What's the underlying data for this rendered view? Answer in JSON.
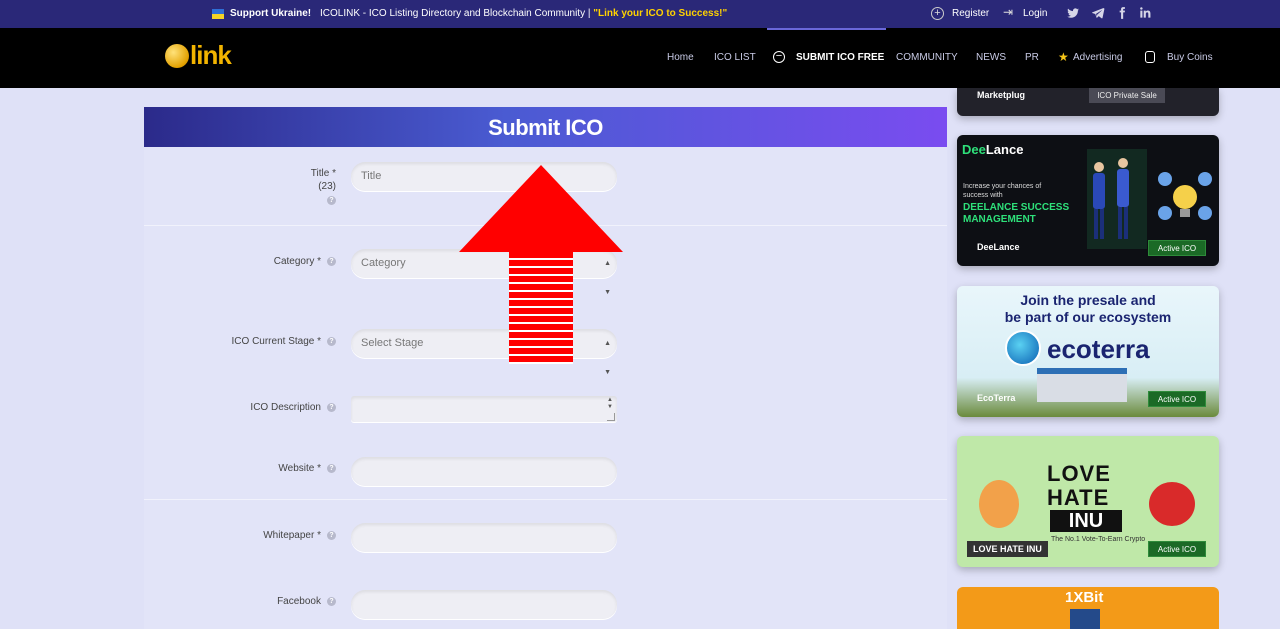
{
  "topbar": {
    "support": "Support Ukraine!",
    "tagline_prefix": "ICOLINK - ICO Listing Directory and Blockchain Community | ",
    "tagline_highlight": "\"Link your ICO to Success!\"",
    "register": "Register",
    "login": "Login",
    "social_icons": [
      "twitter-icon",
      "telegram-icon",
      "facebook-icon",
      "linkedin-icon"
    ]
  },
  "header": {
    "logo_text": "link",
    "nav": {
      "home": "Home",
      "ico_list": "ICO LIST",
      "submit": "SUBMIT ICO FREE",
      "community": "COMMUNITY",
      "news": "NEWS",
      "pr": "PR",
      "advertising": "Advertising",
      "buy_coins": "Buy Coins"
    }
  },
  "form": {
    "title": "Submit ICO",
    "fields": {
      "title_label": "Title *",
      "title_count": "(23)",
      "title_placeholder": "Title",
      "category_label": "Category *",
      "category_value": "Category",
      "stage_label": "ICO Current Stage *",
      "stage_value": "Select Stage",
      "description_label": "ICO Description",
      "website_label": "Website *",
      "whitepaper_label": "Whitepaper *",
      "facebook_label": "Facebook"
    }
  },
  "sidebar": {
    "ads": [
      {
        "name": "Marketplug",
        "status": "ICO Private Sale"
      },
      {
        "name": "DeeLance",
        "brand_a": "Dee",
        "brand_b": "Lance",
        "line1": "Increase your chances of success with",
        "line2a": "DEELANCE SUCCESS",
        "line2b": "MANAGEMENT",
        "status": "Active ICO"
      },
      {
        "name": "EcoTerra",
        "headline_1": "Join the presale and",
        "headline_2": "be part of our ecosystem",
        "logo_text": "ecoterra",
        "status": "Active ICO"
      },
      {
        "name": "LOVE HATE INU",
        "line_1": "LOVE",
        "line_2": "HATE",
        "line_3": "INU",
        "sub": "The No.1 Vote-To-Earn Crypto",
        "status": "Active ICO"
      },
      {
        "name": "1XBit",
        "title": "1XBit"
      }
    ]
  },
  "colors": {
    "topbar_bg": "#2a2878",
    "header_bg": "#000000",
    "page_bg": "#dfe1f7",
    "accent_yellow": "#ffd200",
    "arrow_red": "#ff0000",
    "active_green": "#1b6a26"
  }
}
